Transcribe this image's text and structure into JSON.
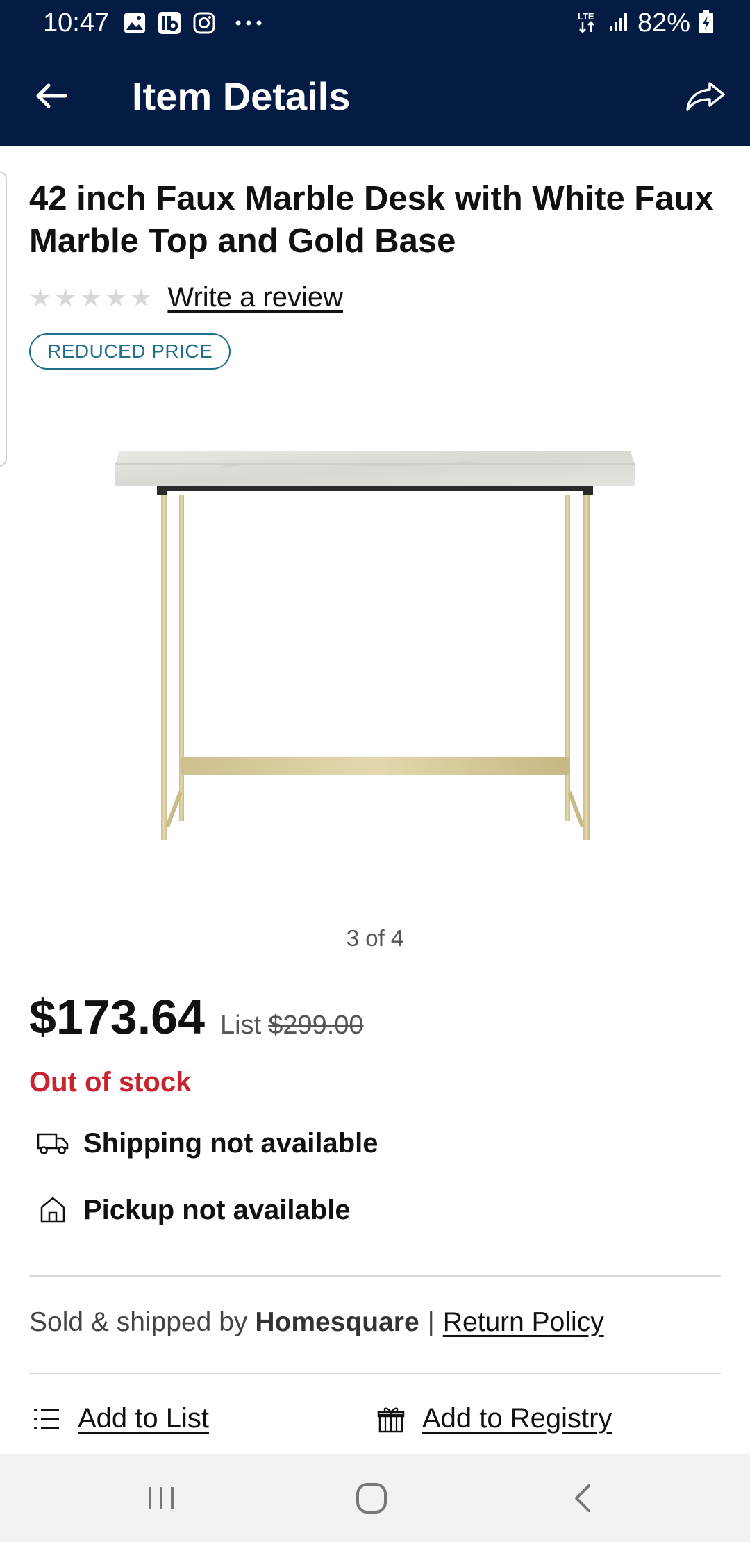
{
  "status_bar": {
    "time": "10:47",
    "battery": "82%",
    "icons": [
      "gallery-icon",
      "ib-app-icon",
      "instagram-icon",
      "more-dots-icon",
      "lte-icon",
      "signal-icon",
      "battery-charging-icon"
    ]
  },
  "app_bar": {
    "title": "Item Details",
    "background": "#041c44"
  },
  "product": {
    "title": "42 inch Faux Marble Desk with White Faux Marble Top and Gold Base",
    "rating": 0,
    "write_review": "Write a review",
    "badge": "REDUCED PRICE",
    "image_counter": "3 of 4",
    "price": "$173.64",
    "list_label": "List",
    "list_price": "$299.00",
    "stock_status": "Out of stock",
    "stock_color": "#c8242f"
  },
  "fulfillment": {
    "shipping": "Shipping not available",
    "pickup": "Pickup not available"
  },
  "seller": {
    "prefix": "Sold & shipped by",
    "name": "Homesquare",
    "separator": "|",
    "return_policy": "Return Policy"
  },
  "actions": {
    "add_to_list": "Add to List",
    "add_to_registry": "Add to Registry"
  }
}
